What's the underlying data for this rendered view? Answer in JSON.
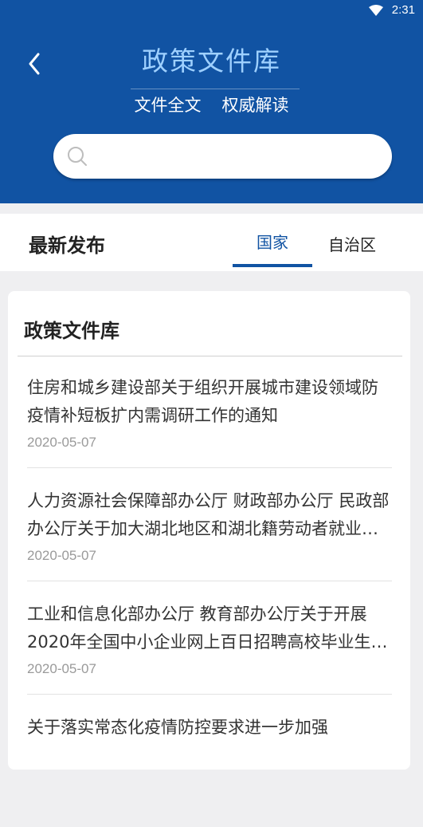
{
  "status_bar": {
    "time": "2:31"
  },
  "header": {
    "title": "政策文件库",
    "tabs": [
      "文件全文",
      "权威解读"
    ],
    "search": {
      "placeholder": "",
      "value": ""
    }
  },
  "tabbar": {
    "section_label": "最新发布",
    "tabs": [
      {
        "label": "国家",
        "selected": true
      },
      {
        "label": "自治区",
        "selected": false
      }
    ]
  },
  "card": {
    "title": "政策文件库",
    "articles": [
      {
        "title": "住房和城乡建设部关于组织开展城市建设领域防疫情补短板扩内需调研工作的通知",
        "date": "2020-05-07"
      },
      {
        "title": "人力资源社会保障部办公厅 财政部办公厅 民政部办公厅关于加大湖北地区和湖北籍劳动者就业支持力度的通知",
        "date": "2020-05-07"
      },
      {
        "title": "工业和信息化部办公厅 教育部办公厅关于开展2020年全国中小企业网上百日招聘高校毕业生活动的通知",
        "date": "2020-05-07"
      },
      {
        "title": "关于落实常态化疫情防控要求进一步加强",
        "date": ""
      }
    ]
  },
  "colors": {
    "header_bg": "#1153a3",
    "title": "#9ed0ff",
    "accent": "#1153a3"
  }
}
